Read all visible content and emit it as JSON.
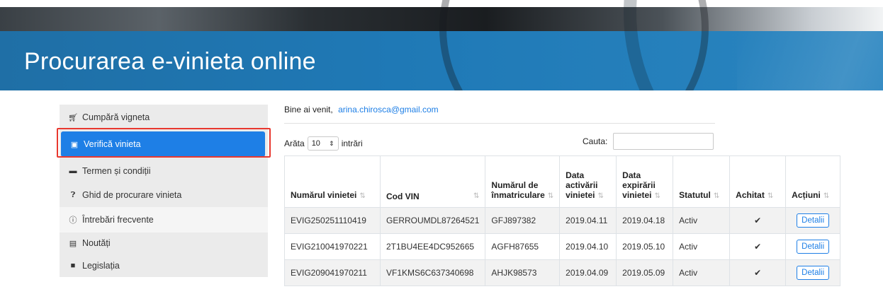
{
  "header": {
    "title": "Procurarea e-vinieta online"
  },
  "sidebar": {
    "items": [
      {
        "label": "Cumpără vigneta",
        "icon": "cart-icon"
      },
      {
        "label": "Verifică vinieta",
        "icon": "briefcase-icon",
        "active": true
      },
      {
        "label": "Termen și condiții",
        "icon": "comments-icon"
      },
      {
        "label": "Ghid de procurare vinieta",
        "icon": "question-circle-icon"
      },
      {
        "label": "Întrebări frecvente",
        "icon": "info-circle-icon"
      },
      {
        "label": "Noutăți",
        "icon": "newspaper-icon"
      },
      {
        "label": "Legislația",
        "icon": "file-icon"
      }
    ],
    "active_color": "#1e7fe6",
    "highlight_color": "#e8382f"
  },
  "welcome": {
    "text": "Bine ai venit,",
    "email": "arina.chirosca@gmail.com"
  },
  "controls": {
    "show_label": "Arăta",
    "show_value": "10",
    "entries_label": "intrări",
    "search_label": "Cauta:",
    "search_value": ""
  },
  "table": {
    "headers": [
      "Numărul vinietei",
      "Cod VIN",
      "Numărul de înmatriculare",
      "Data activării vinietei",
      "Data expirării vinietei",
      "Statutul",
      "Achitat",
      "Acțiuni"
    ],
    "rows": [
      {
        "number": "EVIG250251110419",
        "vin": "GERROUMDL87264521",
        "plate": "GFJ897382",
        "activated": "2019.04.11",
        "expires": "2019.04.18",
        "status": "Activ",
        "paid": "✔",
        "action": "Detalii"
      },
      {
        "number": "EVIG210041970221",
        "vin": "2T1BU4EE4DC952665",
        "plate": "AGFH87655",
        "activated": "2019.04.10",
        "expires": "2019.05.10",
        "status": "Activ",
        "paid": "✔",
        "action": "Detalii"
      },
      {
        "number": "EVIG209041970211",
        "vin": "VF1KMS6C637340698",
        "plate": "AHJK98573",
        "activated": "2019.04.09",
        "expires": "2019.05.09",
        "status": "Activ",
        "paid": "✔",
        "action": "Detalii"
      }
    ]
  }
}
